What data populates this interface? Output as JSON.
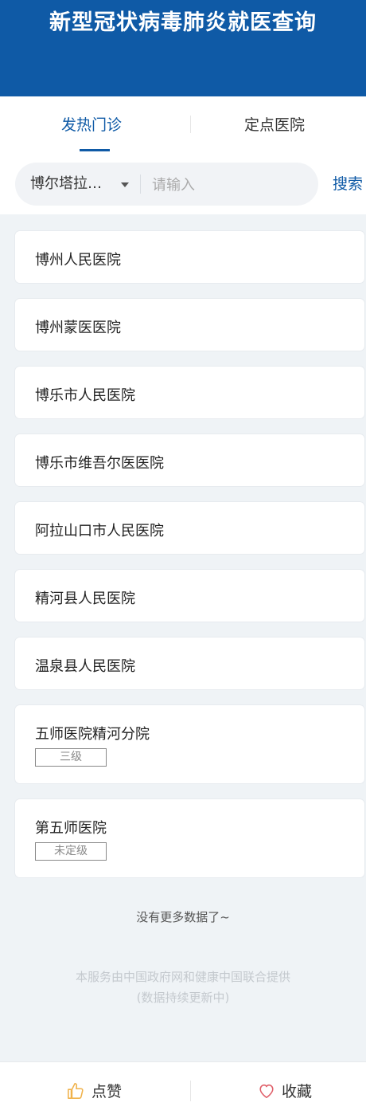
{
  "header": {
    "title": "新型冠状病毒肺炎就医查询"
  },
  "tabs": [
    {
      "label": "发热门诊",
      "active": true
    },
    {
      "label": "定点医院",
      "active": false
    }
  ],
  "search": {
    "city": "博尔塔拉…",
    "placeholder": "请输入",
    "value": "",
    "button_label": "搜索"
  },
  "hospitals": [
    {
      "name": "博州人民医院",
      "level": ""
    },
    {
      "name": "博州蒙医医院",
      "level": ""
    },
    {
      "name": "博乐市人民医院",
      "level": ""
    },
    {
      "name": "博乐市维吾尔医医院",
      "level": ""
    },
    {
      "name": "阿拉山口市人民医院",
      "level": ""
    },
    {
      "name": "精河县人民医院",
      "level": ""
    },
    {
      "name": "温泉县人民医院",
      "level": ""
    },
    {
      "name": "五师医院精河分院",
      "level": "三级"
    },
    {
      "name": "第五师医院",
      "level": "未定级"
    }
  ],
  "list_end_text": "没有更多数据了~",
  "footer": {
    "line1": "本服务由中国政府网和健康中国联合提供",
    "line2": "(数据持续更新中)"
  },
  "bottom_bar": {
    "like_label": "点赞",
    "favorite_label": "收藏"
  },
  "colors": {
    "brand": "#0f5aa6",
    "like_icon": "#f0b24b",
    "favorite_icon": "#e0606a"
  },
  "icons": {
    "like": "thumbs-up-icon",
    "favorite": "heart-icon",
    "dropdown": "caret-down-icon"
  }
}
